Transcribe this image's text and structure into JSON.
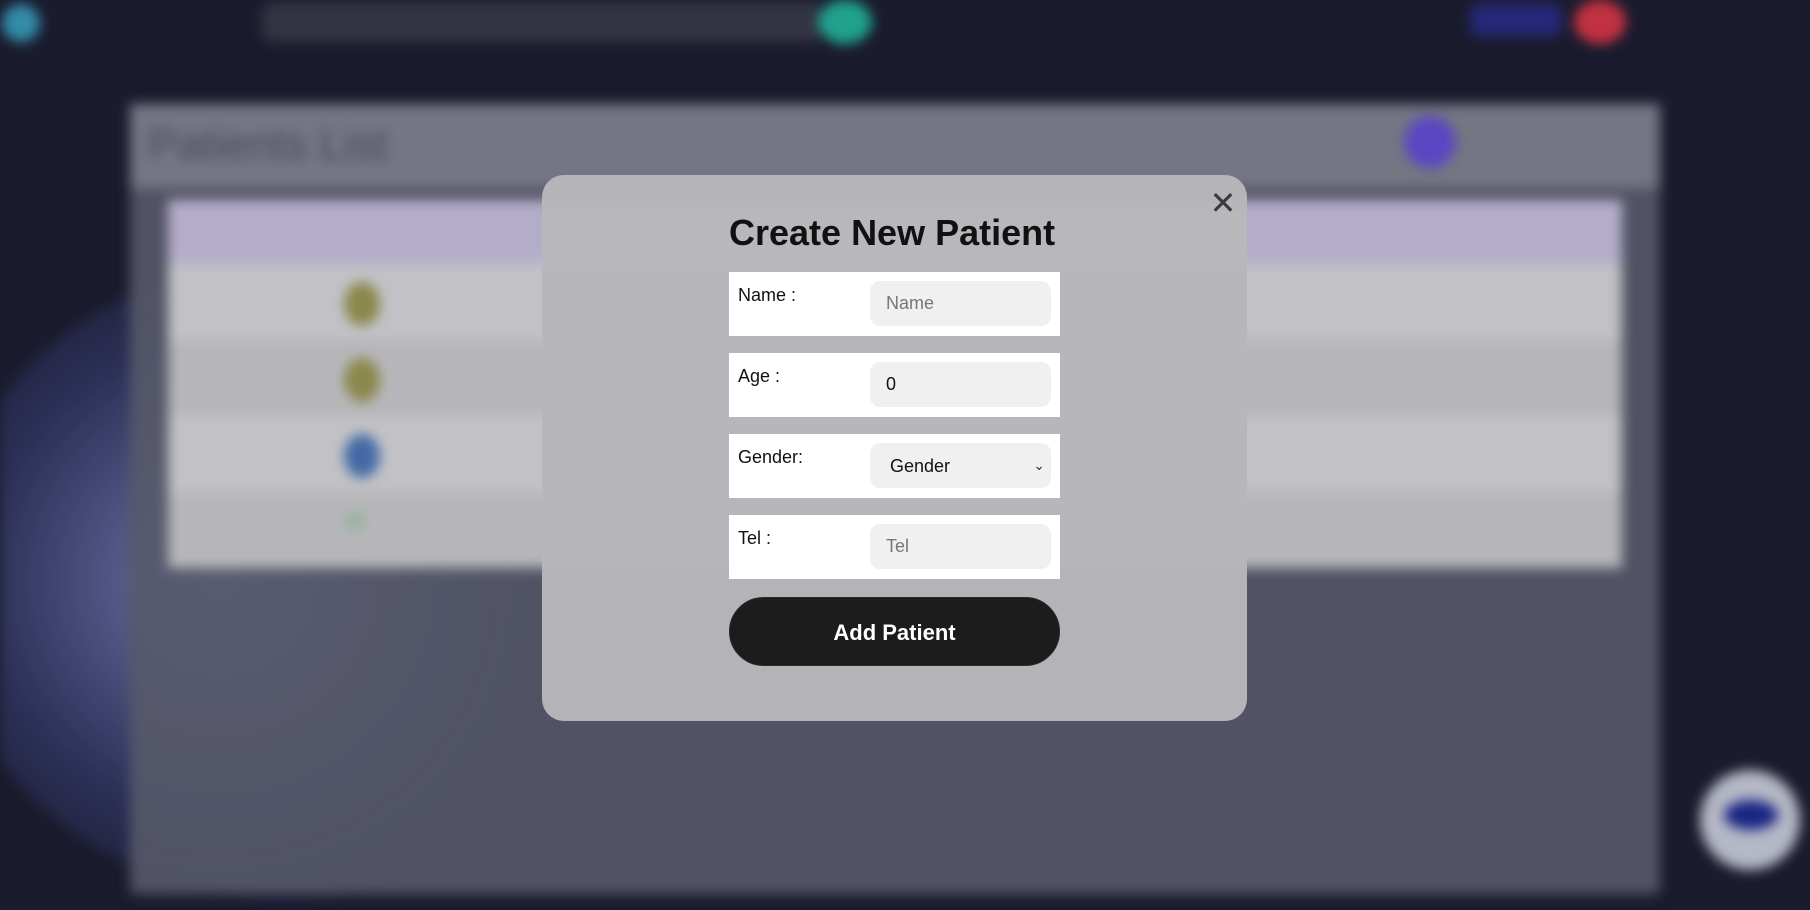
{
  "background": {
    "brand": "",
    "search_placeholder": "",
    "nav": [
      "",
      "",
      ""
    ],
    "nav_active": "",
    "page_title": "Patients List",
    "table": {
      "headers": [
        "",
        "",
        "",
        "",
        ""
      ],
      "rows": [
        [
          "",
          "",
          "",
          "",
          ""
        ],
        [
          "",
          "",
          "",
          "",
          ""
        ],
        [
          "",
          "",
          "",
          "",
          ""
        ],
        [
          "",
          "",
          "",
          "",
          ""
        ]
      ]
    }
  },
  "modal": {
    "title": "Create New Patient",
    "close_glyph": "✕",
    "fields": {
      "name": {
        "label": "Name :",
        "placeholder": "Name"
      },
      "age": {
        "label": "Age :",
        "value": "0"
      },
      "gender": {
        "label": "Gender:",
        "selected": "Gender"
      },
      "tel": {
        "label": "Tel :",
        "placeholder": "Tel"
      }
    },
    "submit_label": "Add Patient"
  },
  "icons": {
    "close": "close-icon",
    "dropdown": "chevron-down-icon"
  }
}
